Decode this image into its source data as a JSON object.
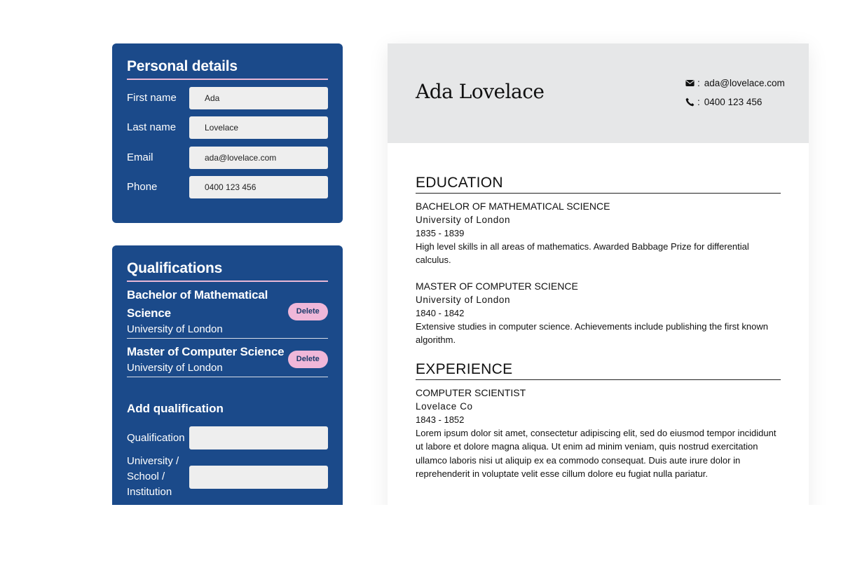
{
  "personal": {
    "title": "Personal details",
    "fields": [
      {
        "label": "First name",
        "value": "Ada"
      },
      {
        "label": "Last name",
        "value": "Lovelace"
      },
      {
        "label": "Email",
        "value": "ada@lovelace.com"
      },
      {
        "label": "Phone",
        "value": "0400 123 456"
      }
    ]
  },
  "qualifications": {
    "title": "Qualifications",
    "items": [
      {
        "title": "Bachelor of Mathematical Science",
        "institution": "University of London",
        "delete_label": "Delete"
      },
      {
        "title": "Master of Computer Science",
        "institution": "University of London",
        "delete_label": "Delete"
      }
    ],
    "add": {
      "title": "Add qualification",
      "qualification_label": "Qualification",
      "qualification_value": "",
      "institution_label": "University / School / Institution",
      "institution_value": ""
    }
  },
  "resume": {
    "name": "Ada Lovelace",
    "email": "ada@lovelace.com",
    "phone": "0400 123 456",
    "contact_separator": ":",
    "education": {
      "heading": "EDUCATION",
      "entries": [
        {
          "title": "Bachelor of Mathematical Science",
          "institution": "University of London",
          "dates": "1835 - 1839",
          "description": "High level skills in all areas of mathematics. Awarded Babbage Prize for differential calculus."
        },
        {
          "title": "Master of Computer Science",
          "institution": "University of London",
          "dates": "1840 - 1842",
          "description": "Extensive studies in computer science. Achievements include publishing the first known algorithm."
        }
      ]
    },
    "experience": {
      "heading": "EXPERIENCE",
      "entries": [
        {
          "title": "Computer Scientist",
          "company": "Lovelace Co",
          "dates": "1843 - 1852",
          "description": "Lorem ipsum dolor sit amet, consectetur adipiscing elit, sed do eiusmod tempor incididunt ut labore et dolore magna aliqua. Ut enim ad minim veniam, quis nostrud exercitation ullamco laboris nisi ut aliquip ex ea commodo consequat. Duis aute irure dolor in reprehenderit in voluptate velit esse cillum dolore eu fugiat nulla pariatur."
        }
      ]
    }
  },
  "colors": {
    "panel": "#1b4a8a",
    "accent_pink": "#f0b7d9",
    "resume_header": "#e6e7e8"
  },
  "icons": {
    "email": "envelope-icon",
    "phone": "phone-icon"
  }
}
